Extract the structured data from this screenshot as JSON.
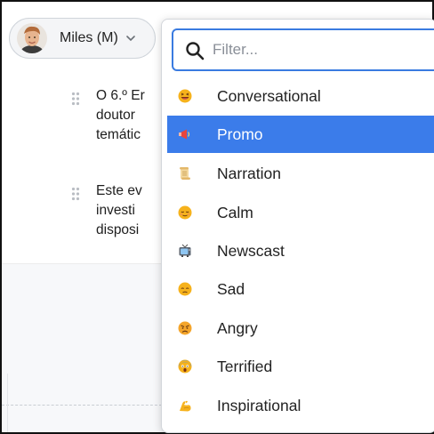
{
  "speaker": {
    "name": "Miles (M)"
  },
  "segments": [
    {
      "lines": [
        "O 6.º Er",
        "doutor",
        "temátic"
      ]
    },
    {
      "lines": [
        "Este ev",
        "investi",
        "disposi"
      ]
    }
  ],
  "dropdown": {
    "filter_placeholder": "Filter...",
    "selected_index": 1,
    "options": [
      {
        "label": "Conversational",
        "icon": "grinning-squinting-face-icon"
      },
      {
        "label": "Promo",
        "icon": "megaphone-icon"
      },
      {
        "label": "Narration",
        "icon": "scroll-icon"
      },
      {
        "label": "Calm",
        "icon": "relieved-face-icon"
      },
      {
        "label": "Newscast",
        "icon": "television-icon"
      },
      {
        "label": "Sad",
        "icon": "sad-face-icon"
      },
      {
        "label": "Angry",
        "icon": "angry-face-icon"
      },
      {
        "label": "Terrified",
        "icon": "screaming-face-icon"
      },
      {
        "label": "Inspirational",
        "icon": "flexed-biceps-icon"
      }
    ]
  },
  "colors": {
    "accent": "#3b7cea",
    "focus_border": "#3a7be0",
    "emoji_yellow": "#f6b21c"
  }
}
